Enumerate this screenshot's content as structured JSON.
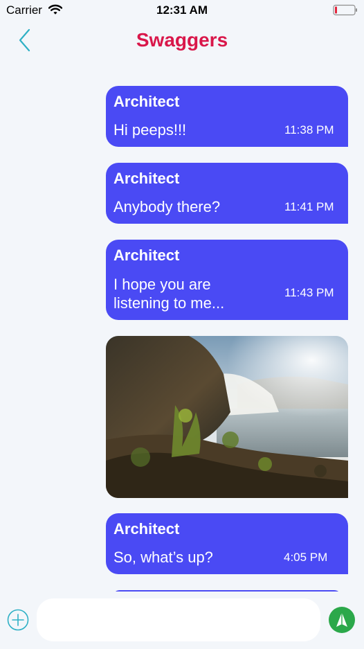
{
  "status_bar": {
    "carrier": "Carrier",
    "time": "12:31 AM",
    "wifi_icon": "wifi-icon",
    "battery_icon": "battery-low-icon",
    "battery_color": "#e2263d"
  },
  "header": {
    "back_icon": "chevron-left-icon",
    "title": "Swaggers",
    "title_color": "#d9174a",
    "accent_color": "#2fb0c5"
  },
  "messages": [
    {
      "sender": "Architect",
      "text": "Hi peeps!!!",
      "time": "11:38 PM"
    },
    {
      "sender": "Architect",
      "text": "Anybody there?",
      "time": "11:41 PM"
    },
    {
      "sender": "Architect",
      "text": "I hope you are listening to me...",
      "time": "11:43 PM"
    },
    {
      "type": "image",
      "description_icon": "waterfall-photo"
    },
    {
      "sender": "Architect",
      "text": "So, what’s up?",
      "time": "4:05 PM"
    }
  ],
  "bubble_color": "#4a4af4",
  "input_bar": {
    "add_icon": "plus-circle-icon",
    "input_value": "",
    "input_placeholder": "",
    "send_icon": "send-arrow-icon",
    "send_color": "#2ba84a"
  }
}
